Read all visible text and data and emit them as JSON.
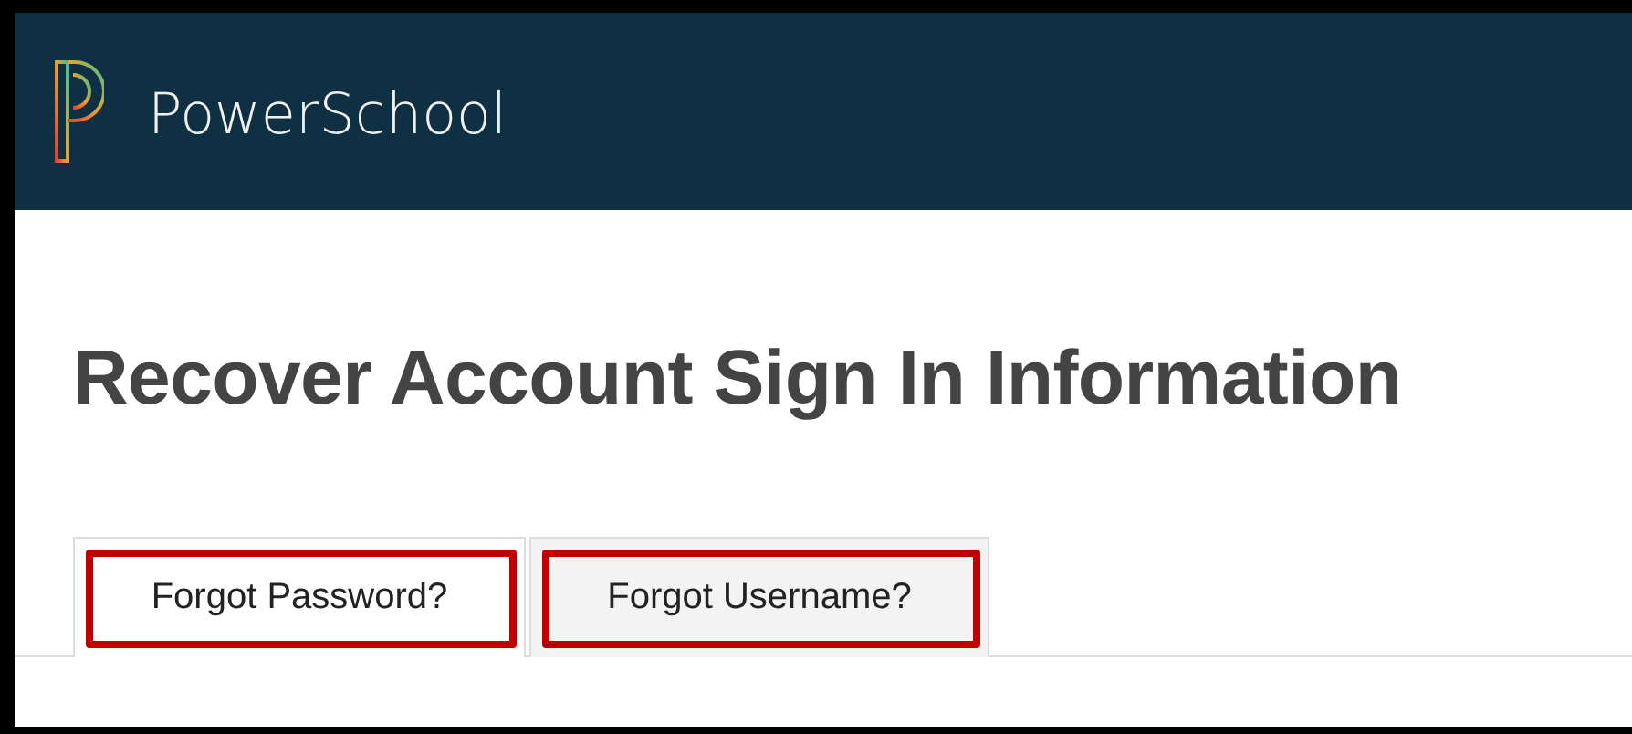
{
  "header": {
    "brand": "PowerSchool"
  },
  "title": "Recover Account Sign In Information",
  "tabs": [
    {
      "label": "Forgot Password?",
      "selected": true,
      "highlighted": true
    },
    {
      "label": "Forgot Username?",
      "selected": false,
      "highlighted": true
    }
  ]
}
